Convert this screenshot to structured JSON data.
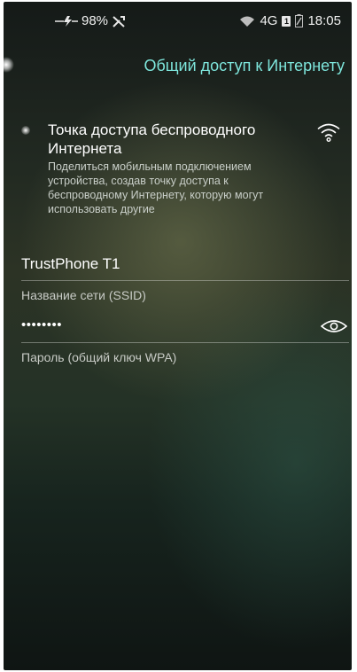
{
  "status_bar": {
    "battery": "98%",
    "network": "4G",
    "sim_slot": "1",
    "time": "18:05"
  },
  "header": {
    "title": "Общий доступ к Интернету"
  },
  "hotspot": {
    "title": "Точка доступа беспроводного Интернета",
    "description": "Поделиться мобильным подключением устройства, создав точку доступа к беспроводному Интернету, которую могут использовать другие"
  },
  "ssid_field": {
    "value": "TrustPhone T1",
    "label": "Название сети (SSID)"
  },
  "password_field": {
    "value": "••••••••",
    "label": "Пароль (общий ключ WPA)"
  },
  "colors": {
    "accent": "#7ee6dc"
  },
  "icons": [
    "battery-charging-icon",
    "no-signal-icon",
    "wifi-signal-icon",
    "sim-icon",
    "wifi-hotspot-icon",
    "eye-icon"
  ]
}
